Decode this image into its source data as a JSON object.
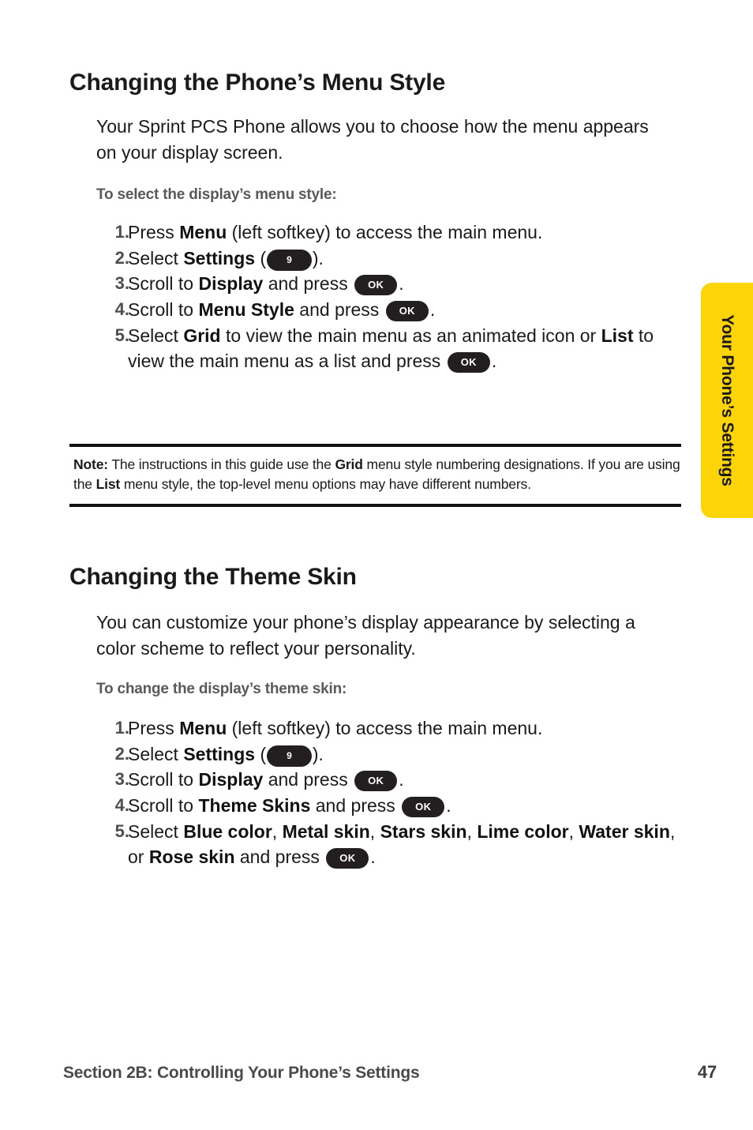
{
  "page": {
    "number": "47",
    "footer_section": "Section 2B: Controlling Your Phone’s Settings",
    "side_tab_label": "Your Phone’s Settings",
    "accent_yellow": "#FCD408",
    "key_pill_color": "#231f20"
  },
  "sections": [
    {
      "title": "Changing the Phone’s Menu Style",
      "intro": "Your Sprint PCS Phone allows you to choose how the menu appears on your display screen.",
      "subhead": "To select the display’s menu style:",
      "steps": [
        {
          "num": "1.",
          "parts": [
            {
              "t": "Press ",
              "b": false
            },
            {
              "t": "Menu",
              "b": true
            },
            {
              "t": " (left softkey) to access the main menu.",
              "b": false
            }
          ]
        },
        {
          "num": "2.",
          "parts": [
            {
              "t": "Select ",
              "b": false
            },
            {
              "t": "Settings",
              "b": true
            },
            {
              "t": " (",
              "b": false
            },
            {
              "key": "9"
            },
            {
              "t": ").",
              "b": false
            }
          ]
        },
        {
          "num": "3.",
          "parts": [
            {
              "t": "Scroll to ",
              "b": false
            },
            {
              "t": "Display",
              "b": true
            },
            {
              "t": " and press ",
              "b": false
            },
            {
              "key": "OK"
            },
            {
              "t": ".",
              "b": false
            }
          ]
        },
        {
          "num": "4.",
          "parts": [
            {
              "t": "Scroll to ",
              "b": false
            },
            {
              "t": "Menu Style",
              "b": true
            },
            {
              "t": " and press ",
              "b": false
            },
            {
              "key": "OK"
            },
            {
              "t": ".",
              "b": false
            }
          ]
        },
        {
          "num": "5.",
          "parts": [
            {
              "t": "Select ",
              "b": false
            },
            {
              "t": "Grid",
              "b": true
            },
            {
              "t": " to view the main menu as an animated icon or ",
              "b": false
            },
            {
              "t": "List",
              "b": true
            },
            {
              "t": " to view the main menu as a list and press ",
              "b": false
            },
            {
              "key": "OK"
            },
            {
              "t": ".",
              "b": false
            }
          ]
        }
      ],
      "note": {
        "label": "Note:",
        "parts": [
          {
            "t": " The instructions in this guide use the ",
            "b": false
          },
          {
            "t": "Grid",
            "b": true
          },
          {
            "t": " menu style numbering designations. If you are using the ",
            "b": false
          },
          {
            "t": "List",
            "b": true
          },
          {
            "t": " menu style, the top-level menu options may have different numbers.",
            "b": false
          }
        ]
      }
    },
    {
      "title": "Changing the Theme Skin",
      "intro": "You can customize your phone’s display appearance by selecting a color scheme to reflect your personality.",
      "subhead": "To change the display’s theme skin:",
      "steps": [
        {
          "num": "1.",
          "parts": [
            {
              "t": "Press ",
              "b": false
            },
            {
              "t": "Menu",
              "b": true
            },
            {
              "t": " (left softkey) to access the main menu.",
              "b": false
            }
          ]
        },
        {
          "num": "2.",
          "parts": [
            {
              "t": "Select ",
              "b": false
            },
            {
              "t": "Settings",
              "b": true
            },
            {
              "t": " (",
              "b": false
            },
            {
              "key": "9"
            },
            {
              "t": ").",
              "b": false
            }
          ]
        },
        {
          "num": "3.",
          "parts": [
            {
              "t": "Scroll to ",
              "b": false
            },
            {
              "t": "Display",
              "b": true
            },
            {
              "t": " and press ",
              "b": false
            },
            {
              "key": "OK"
            },
            {
              "t": ".",
              "b": false
            }
          ]
        },
        {
          "num": "4.",
          "parts": [
            {
              "t": "Scroll to ",
              "b": false
            },
            {
              "t": "Theme Skins",
              "b": true
            },
            {
              "t": " and press ",
              "b": false
            },
            {
              "key": "OK"
            },
            {
              "t": ".",
              "b": false
            }
          ]
        },
        {
          "num": "5.",
          "parts": [
            {
              "t": "Select ",
              "b": false
            },
            {
              "t": "Blue color",
              "b": true
            },
            {
              "t": ", ",
              "b": false
            },
            {
              "t": "Metal skin",
              "b": true
            },
            {
              "t": ", ",
              "b": false
            },
            {
              "t": "Stars skin",
              "b": true
            },
            {
              "t": ", ",
              "b": false
            },
            {
              "t": "Lime color",
              "b": true
            },
            {
              "t": ", ",
              "b": false
            },
            {
              "t": "Water skin",
              "b": true
            },
            {
              "t": ", or ",
              "b": false
            },
            {
              "t": "Rose skin",
              "b": true
            },
            {
              "t": " and press ",
              "b": false
            },
            {
              "key": "OK"
            },
            {
              "t": ".",
              "b": false
            }
          ]
        }
      ]
    }
  ]
}
